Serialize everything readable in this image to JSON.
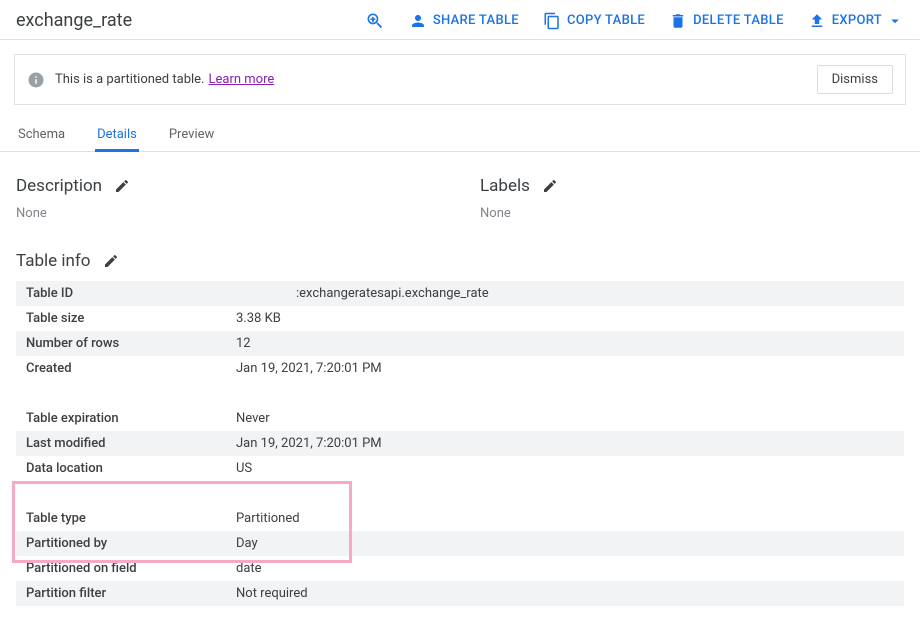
{
  "header": {
    "title": "exchange_rate",
    "actions": {
      "share": "SHARE TABLE",
      "copy": "COPY TABLE",
      "delete": "DELETE TABLE",
      "export": "EXPORT"
    }
  },
  "notice": {
    "text": "This is a partitioned table.",
    "learn_more": "Learn more",
    "dismiss": "Dismiss"
  },
  "tabs": {
    "schema": "Schema",
    "details": "Details",
    "preview": "Preview"
  },
  "description": {
    "heading": "Description",
    "value": "None"
  },
  "labels": {
    "heading": "Labels",
    "value": "None"
  },
  "table_info": {
    "heading": "Table info",
    "rows": {
      "table_id": {
        "k": "Table ID",
        "v": ":exchangeratesapi.exchange_rate"
      },
      "table_size": {
        "k": "Table size",
        "v": "3.38 KB"
      },
      "num_rows": {
        "k": "Number of rows",
        "v": "12"
      },
      "created": {
        "k": "Created",
        "v": "Jan 19, 2021, 7:20:01 PM"
      },
      "expiration": {
        "k": "Table expiration",
        "v": "Never"
      },
      "last_modified": {
        "k": "Last modified",
        "v": "Jan 19, 2021, 7:20:01 PM"
      },
      "data_location": {
        "k": "Data location",
        "v": "US"
      },
      "table_type": {
        "k": "Table type",
        "v": "Partitioned"
      },
      "partitioned_by": {
        "k": "Partitioned by",
        "v": "Day"
      },
      "partitioned_on": {
        "k": "Partitioned on field",
        "v": "date"
      },
      "partition_filter": {
        "k": "Partition filter",
        "v": "Not required"
      }
    }
  }
}
